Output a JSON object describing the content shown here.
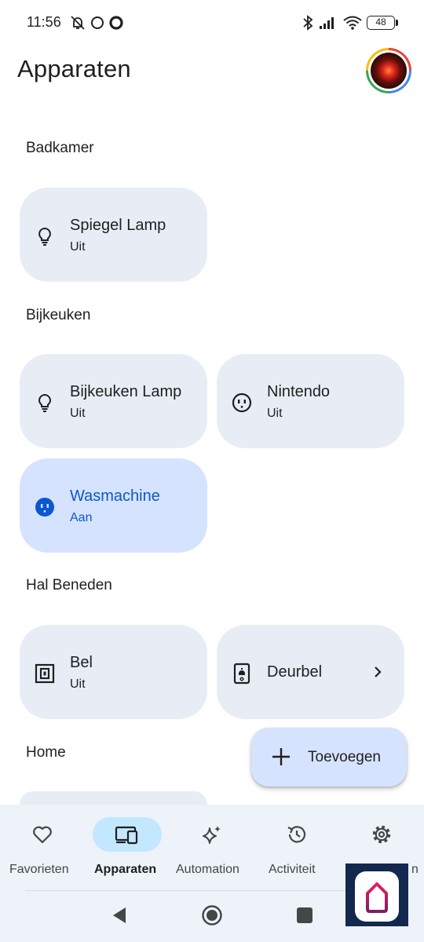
{
  "status_bar": {
    "time": "11:56",
    "battery": "48",
    "icons": [
      "muted-icon",
      "circle-icon",
      "ring-icon",
      "bluetooth-icon",
      "signal-icon",
      "wifi-icon",
      "battery-icon"
    ]
  },
  "header": {
    "title": "Apparaten",
    "avatar_icon": "profile-avatar"
  },
  "sections": [
    {
      "title": "Badkamer"
    },
    {
      "title": "Bijkeuken"
    },
    {
      "title": "Hal Beneden"
    },
    {
      "title": "Home"
    }
  ],
  "devices": {
    "spiegel_lamp": {
      "name": "Spiegel Lamp",
      "state": "Uit",
      "icon": "lightbulb-icon"
    },
    "bijkeuken_lamp": {
      "name": "Bijkeuken Lamp",
      "state": "Uit",
      "icon": "lightbulb-icon"
    },
    "nintendo": {
      "name": "Nintendo",
      "state": "Uit",
      "icon": "outlet-icon"
    },
    "wasmachine": {
      "name": "Wasmachine",
      "state": "Aan",
      "icon": "outlet-icon",
      "on": true
    },
    "bel": {
      "name": "Bel",
      "state": "Uit",
      "icon": "doorbell-icon"
    },
    "deurbel": {
      "name": "Deurbel",
      "icon": "doorbell-camera-icon",
      "chevron": "chevron-right-icon"
    }
  },
  "fab": {
    "label": "Toevoegen",
    "icon": "plus-icon"
  },
  "bottom_nav": [
    {
      "label": "Favorieten",
      "icon": "heart-icon"
    },
    {
      "label": "Apparaten",
      "icon": "devices-icon",
      "active": true
    },
    {
      "label": "Automation",
      "icon": "sparkle-icon"
    },
    {
      "label": "Activiteit",
      "icon": "history-icon"
    },
    {
      "label": "n",
      "icon": "settings-icon"
    }
  ],
  "system_nav": [
    "back-icon",
    "home-icon",
    "recents-icon"
  ],
  "colors": {
    "tile_off": "#e8edf5",
    "tile_on": "#d6e3ff",
    "accent_on": "#0b57d0",
    "nav_bg": "#eef2f9",
    "nav_active_pill": "#c2e7ff",
    "badge_bg": "#13284e"
  }
}
